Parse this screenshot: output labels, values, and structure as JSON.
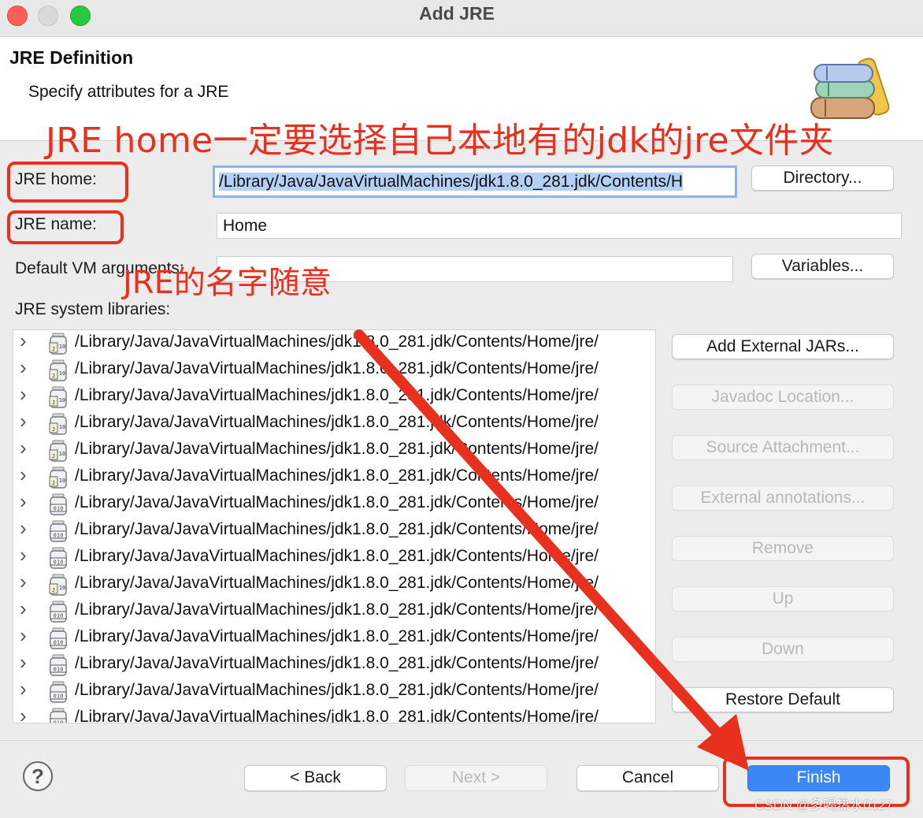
{
  "window": {
    "title": "Add JRE"
  },
  "header": {
    "title": "JRE Definition",
    "subtitle": "Specify attributes for a JRE"
  },
  "annotations": {
    "home_note": "JRE home一定要选择自己本地有的jdk的jre文件夹",
    "name_note": "JRE的名字随意",
    "color": "#e8301f"
  },
  "form": {
    "jre_home_label": "JRE home:",
    "jre_home_value": "/Library/Java/JavaVirtualMachines/jdk1.8.0_281.jdk/Contents/H",
    "directory_button": "Directory...",
    "jre_name_label": "JRE name:",
    "jre_name_value": "Home",
    "vm_args_label": "Default VM arguments:",
    "vm_args_value": "",
    "variables_button": "Variables...",
    "system_libraries_label": "JRE system libraries:"
  },
  "libraries": {
    "rows": [
      {
        "path": "/Library/Java/JavaVirtualMachines/jdk1.8.0_281.jdk/Contents/Home/jre/",
        "icon": "jar-source-icon"
      },
      {
        "path": "/Library/Java/JavaVirtualMachines/jdk1.8.0_281.jdk/Contents/Home/jre/",
        "icon": "jar-source-icon"
      },
      {
        "path": "/Library/Java/JavaVirtualMachines/jdk1.8.0_281.jdk/Contents/Home/jre/",
        "icon": "jar-source-icon"
      },
      {
        "path": "/Library/Java/JavaVirtualMachines/jdk1.8.0_281.jdk/Contents/Home/jre/",
        "icon": "jar-source-icon"
      },
      {
        "path": "/Library/Java/JavaVirtualMachines/jdk1.8.0_281.jdk/Contents/Home/jre/",
        "icon": "jar-source-icon"
      },
      {
        "path": "/Library/Java/JavaVirtualMachines/jdk1.8.0_281.jdk/Contents/Home/jre/",
        "icon": "jar-source-icon"
      },
      {
        "path": "/Library/Java/JavaVirtualMachines/jdk1.8.0_281.jdk/Contents/Home/jre/",
        "icon": "jar-binary-icon"
      },
      {
        "path": "/Library/Java/JavaVirtualMachines/jdk1.8.0_281.jdk/Contents/Home/jre/",
        "icon": "jar-binary-icon"
      },
      {
        "path": "/Library/Java/JavaVirtualMachines/jdk1.8.0_281.jdk/Contents/Home/jre/",
        "icon": "jar-binary-icon"
      },
      {
        "path": "/Library/Java/JavaVirtualMachines/jdk1.8.0_281.jdk/Contents/Home/jre/",
        "icon": "jar-source-icon"
      },
      {
        "path": "/Library/Java/JavaVirtualMachines/jdk1.8.0_281.jdk/Contents/Home/jre/",
        "icon": "jar-binary-icon"
      },
      {
        "path": "/Library/Java/JavaVirtualMachines/jdk1.8.0_281.jdk/Contents/Home/jre/",
        "icon": "jar-binary-icon"
      },
      {
        "path": "/Library/Java/JavaVirtualMachines/jdk1.8.0_281.jdk/Contents/Home/jre/",
        "icon": "jar-binary-icon"
      },
      {
        "path": "/Library/Java/JavaVirtualMachines/jdk1.8.0_281.jdk/Contents/Home/jre/",
        "icon": "jar-binary-icon"
      },
      {
        "path": "/Library/Java/JavaVirtualMachines/jdk1.8.0_281.jdk/Contents/Home/jre/",
        "icon": "jar-binary-icon"
      }
    ]
  },
  "side_buttons": {
    "add_external_jars": "Add External JARs...",
    "javadoc_location": "Javadoc Location...",
    "source_attachment": "Source Attachment...",
    "external_annotations": "External annotations...",
    "remove": "Remove",
    "up": "Up",
    "down": "Down",
    "restore_default": "Restore Default"
  },
  "footer": {
    "help_glyph": "?",
    "back": "< Back",
    "next": "Next >",
    "cancel": "Cancel",
    "finish": "Finish"
  },
  "watermark": "CSDN @多喝热水0127"
}
